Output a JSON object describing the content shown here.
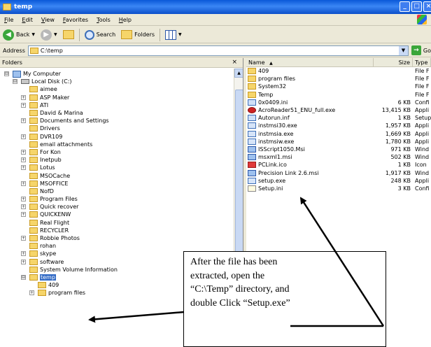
{
  "window": {
    "title": "temp",
    "buttons": [
      "_",
      "□",
      "×"
    ]
  },
  "menubar": [
    "File",
    "Edit",
    "View",
    "Favorites",
    "Tools",
    "Help"
  ],
  "toolbar": {
    "back": "Back",
    "search": "Search",
    "folders": "Folders"
  },
  "address": {
    "label": "Address",
    "value": "C:\\temp",
    "go": "Go"
  },
  "folders_pane": {
    "title": "Folders",
    "close": "×"
  },
  "tree": [
    {
      "label": "My Computer",
      "level": 0,
      "icon": "computer-icon",
      "expander": "⊟"
    },
    {
      "label": "Local Disk (C:)",
      "level": 1,
      "icon": "drive-icon",
      "expander": "⊟"
    },
    {
      "label": "aimee",
      "level": 2,
      "icon": "folder-icon",
      "expander": ""
    },
    {
      "label": "ASP Maker",
      "level": 2,
      "icon": "folder-icon",
      "expander": "+"
    },
    {
      "label": "ATI",
      "level": 2,
      "icon": "folder-icon",
      "expander": "+"
    },
    {
      "label": "David & Marina",
      "level": 2,
      "icon": "folder-icon",
      "expander": ""
    },
    {
      "label": "Documents and Settings",
      "level": 2,
      "icon": "folder-icon",
      "expander": "+"
    },
    {
      "label": "Drivers",
      "level": 2,
      "icon": "folder-icon",
      "expander": ""
    },
    {
      "label": "DVR109",
      "level": 2,
      "icon": "folder-icon",
      "expander": "+"
    },
    {
      "label": "email attachments",
      "level": 2,
      "icon": "folder-icon",
      "expander": ""
    },
    {
      "label": "For Kon",
      "level": 2,
      "icon": "folder-icon",
      "expander": "+"
    },
    {
      "label": "Inetpub",
      "level": 2,
      "icon": "folder-icon",
      "expander": "+"
    },
    {
      "label": "Lotus",
      "level": 2,
      "icon": "folder-icon",
      "expander": "+"
    },
    {
      "label": "MSOCache",
      "level": 2,
      "icon": "folder-icon",
      "expander": ""
    },
    {
      "label": "MSOFFICE",
      "level": 2,
      "icon": "folder-icon",
      "expander": "+"
    },
    {
      "label": "NofD",
      "level": 2,
      "icon": "folder-icon",
      "expander": ""
    },
    {
      "label": "Program Files",
      "level": 2,
      "icon": "folder-icon",
      "expander": "+"
    },
    {
      "label": "Quick recover",
      "level": 2,
      "icon": "folder-icon",
      "expander": "+"
    },
    {
      "label": "QUICKENW",
      "level": 2,
      "icon": "folder-icon",
      "expander": "+"
    },
    {
      "label": "Real Flight",
      "level": 2,
      "icon": "folder-icon",
      "expander": ""
    },
    {
      "label": "RECYCLER",
      "level": 2,
      "icon": "folder-icon",
      "expander": ""
    },
    {
      "label": "Robbie Photos",
      "level": 2,
      "icon": "folder-icon",
      "expander": "+"
    },
    {
      "label": "rohan",
      "level": 2,
      "icon": "folder-icon",
      "expander": ""
    },
    {
      "label": "skype",
      "level": 2,
      "icon": "folder-icon",
      "expander": "+"
    },
    {
      "label": "software",
      "level": 2,
      "icon": "folder-icon",
      "expander": "+"
    },
    {
      "label": "System Volume Information",
      "level": 2,
      "icon": "folder-icon",
      "expander": ""
    },
    {
      "label": "temp",
      "level": 2,
      "icon": "folder-icon",
      "expander": "⊟",
      "selected": true
    },
    {
      "label": "409",
      "level": 3,
      "icon": "folder-icon",
      "expander": ""
    },
    {
      "label": "program files",
      "level": 3,
      "icon": "folder-icon",
      "expander": "+"
    }
  ],
  "files": {
    "columns": [
      "Name",
      "Size",
      "Type"
    ],
    "sort_indicator": "▲",
    "rows": [
      {
        "name": "409",
        "size": "",
        "type": "File F",
        "icon": "folder-icon"
      },
      {
        "name": "program files",
        "size": "",
        "type": "File F",
        "icon": "folder-icon"
      },
      {
        "name": "System32",
        "size": "",
        "type": "File F",
        "icon": "folder-icon"
      },
      {
        "name": "Temp",
        "size": "",
        "type": "File F",
        "icon": "folder-icon"
      },
      {
        "name": "0x0409.ini",
        "size": "6 KB",
        "type": "Confi",
        "icon": "setup-icon"
      },
      {
        "name": "AcroReader51_ENU_full.exe",
        "size": "13,415 KB",
        "type": "Appli",
        "icon": "acrobat-icon"
      },
      {
        "name": "Autorun.inf",
        "size": "1 KB",
        "type": "Setup",
        "icon": "setup-icon"
      },
      {
        "name": "instmsi30.exe",
        "size": "1,957 KB",
        "type": "Appli",
        "icon": "exe-icon"
      },
      {
        "name": "instmsia.exe",
        "size": "1,669 KB",
        "type": "Appli",
        "icon": "exe-icon"
      },
      {
        "name": "instmsiw.exe",
        "size": "1,780 KB",
        "type": "Appli",
        "icon": "exe-icon"
      },
      {
        "name": "ISScript1050.Msi",
        "size": "971 KB",
        "type": "Wind",
        "icon": "msi-icon"
      },
      {
        "name": "msxml1.msi",
        "size": "502 KB",
        "type": "Wind",
        "icon": "msi-icon"
      },
      {
        "name": "PCLink.ico",
        "size": "1 KB",
        "type": "Icon",
        "icon": "ico-file-icon"
      },
      {
        "name": "Precision Link 2.6.msi",
        "size": "1,917 KB",
        "type": "Wind",
        "icon": "msi-icon"
      },
      {
        "name": "setup.exe",
        "size": "248 KB",
        "type": "Appli",
        "icon": "exe-icon"
      },
      {
        "name": "Setup.ini",
        "size": "3 KB",
        "type": "Confi",
        "icon": "ini-icon"
      }
    ]
  },
  "callout": {
    "text": "After the file has been extracted, open the “C:\\Temp” directory, and double Click “Setup.exe”"
  }
}
